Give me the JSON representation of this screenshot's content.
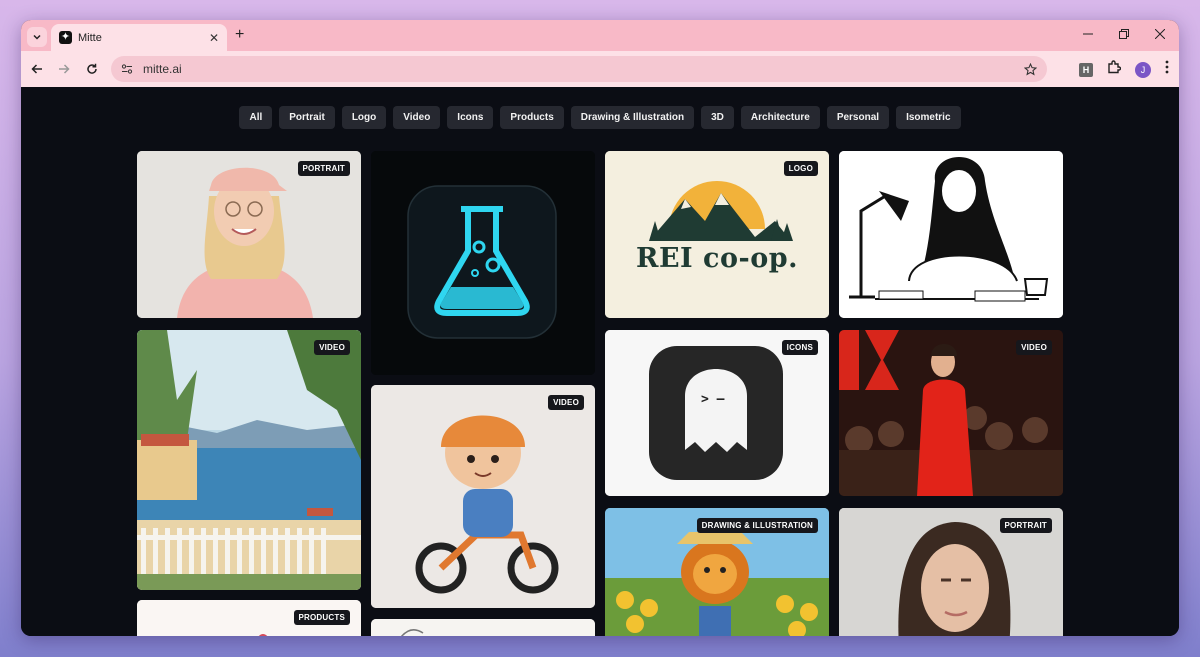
{
  "browser": {
    "tab_title": "Mitte",
    "url": "mitte.ai",
    "profile_initial": "J",
    "extension_label": "H"
  },
  "filters": [
    "All",
    "Portrait",
    "Logo",
    "Video",
    "Icons",
    "Products",
    "Drawing & Illustration",
    "3D",
    "Architecture",
    "Personal",
    "Isometric"
  ],
  "gallery": [
    {
      "badge": "PORTRAIT",
      "subject": "woman-with-pink-cap"
    },
    {
      "badge": "",
      "subject": "glowing-flask-icon"
    },
    {
      "badge": "LOGO",
      "subject": "rei-coop-logo",
      "logo_text": "REI co-op."
    },
    {
      "badge": "",
      "subject": "woman-drawing-line-art"
    },
    {
      "badge": "VIDEO",
      "subject": "coastal-painting"
    },
    {
      "badge": "VIDEO",
      "subject": "boy-on-bike-3d"
    },
    {
      "badge": "ICONS",
      "subject": "ghost-terminal-icon",
      "ghost_text": "> —"
    },
    {
      "badge": "VIDEO",
      "subject": "woman-speaking-on-stage"
    },
    {
      "badge": "PRODUCTS",
      "subject": "product-partial"
    },
    {
      "badge": "",
      "subject": "sketch-partial"
    },
    {
      "badge": "DRAWING & ILLUSTRATION",
      "subject": "lion-farmer-illustration"
    },
    {
      "badge": "PORTRAIT",
      "subject": "woman-portrait"
    }
  ]
}
